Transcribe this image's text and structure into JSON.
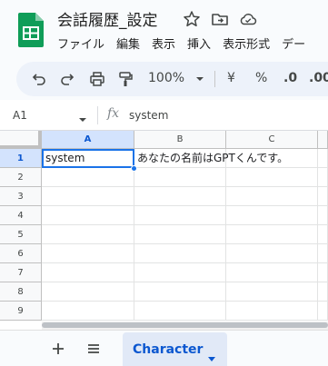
{
  "header": {
    "title": "会話履歴_設定",
    "menu": [
      "ファイル",
      "編集",
      "表示",
      "挿入",
      "表示形式",
      "デー"
    ]
  },
  "toolbar": {
    "zoom": "100%",
    "currency_label": "¥",
    "percent_label": "%",
    "decrease_decimal_label": ".0",
    "increase_decimal_label": ".00"
  },
  "formula_bar": {
    "cell_ref": "A1",
    "fx_label": "fx",
    "value": "system"
  },
  "grid": {
    "columns": [
      "A",
      "B",
      "C"
    ],
    "rows": [
      "1",
      "2",
      "3",
      "4",
      "5",
      "6",
      "7",
      "8",
      "9"
    ],
    "cells": {
      "A1": "system",
      "B1": "あなたの名前はGPTくんです。"
    },
    "selected_cell": "A1"
  },
  "sheets": {
    "tabs": [
      {
        "label": "Character",
        "active": true
      }
    ]
  },
  "colors": {
    "accent": "#1a73e8",
    "tab_text": "#0b57d0",
    "logo_green": "#0f9d58"
  }
}
